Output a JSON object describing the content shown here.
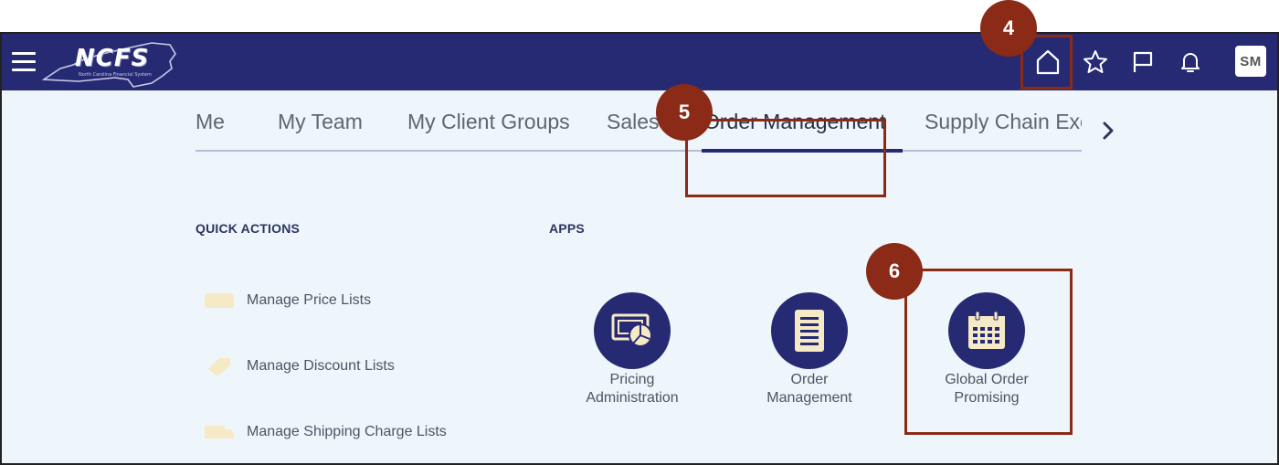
{
  "header": {
    "logo_text": "NCFS",
    "logo_subtitle": "North Carolina Financial System",
    "avatar_initials": "SM",
    "icons": [
      "menu-icon",
      "home-icon",
      "favorites-star-icon",
      "flag-icon",
      "notifications-bell-icon"
    ]
  },
  "tabs": [
    {
      "label": "Me"
    },
    {
      "label": "My Team"
    },
    {
      "label": "My Client Groups"
    },
    {
      "label": "Sales"
    },
    {
      "label": "Order Management",
      "active": true
    },
    {
      "label": "Supply Chain Execu"
    }
  ],
  "quick_actions": {
    "heading": "QUICK ACTIONS",
    "items": [
      {
        "label": "Manage Price Lists",
        "icon": "price-list-icon"
      },
      {
        "label": "Manage Discount Lists",
        "icon": "discount-tag-icon"
      },
      {
        "label": "Manage Shipping Charge Lists",
        "icon": "shipping-truck-icon"
      }
    ]
  },
  "apps": {
    "heading": "APPS",
    "items": [
      {
        "line1": "Pricing",
        "line2": "Administration",
        "icon": "pricing-admin-icon"
      },
      {
        "line1": "Order",
        "line2": "Management",
        "icon": "order-document-icon"
      },
      {
        "line1": "Global Order",
        "line2": "Promising",
        "icon": "calendar-icon"
      }
    ]
  },
  "callouts": {
    "home": "4",
    "order_management_tab": "5",
    "global_order_promising": "6"
  },
  "colors": {
    "header_bg": "#262a73",
    "page_bg": "#eef6fb",
    "callout": "#8b2a16",
    "text_muted": "#5d6770"
  }
}
